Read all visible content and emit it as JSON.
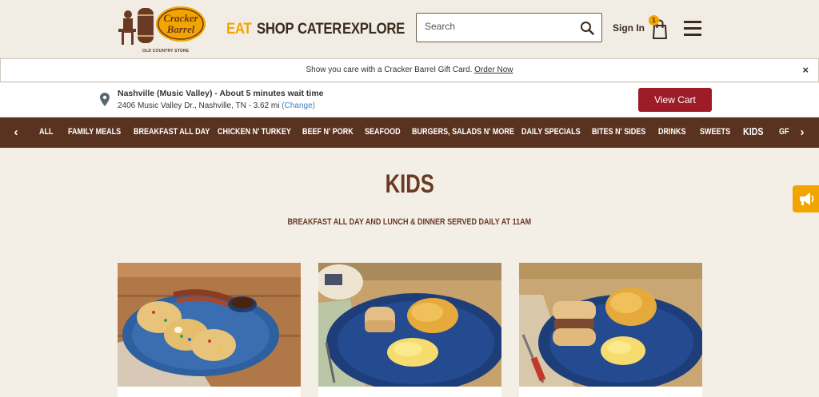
{
  "header": {
    "logo_alt": "Cracker Barrel",
    "logo_subtitle": "OLD COUNTRY STORE",
    "nav": [
      {
        "label": "EAT",
        "active": true
      },
      {
        "label": "SHOP",
        "active": false
      },
      {
        "label": "CATER",
        "active": false
      },
      {
        "label": "EXPLORE",
        "active": false
      }
    ],
    "search_placeholder": "Search",
    "signin_label": "Sign In",
    "cart_count": "1"
  },
  "banner": {
    "text": "Show you care with a Cracker Barrel Gift Card.",
    "link": "Order Now",
    "close": "×"
  },
  "location": {
    "name": "Nashville (Music Valley) - About 5 minutes wait time",
    "address": "2406 Music Valley Dr., Nashville, TN - 3.62 mi",
    "change_link": "(Change)",
    "view_cart_label": "View Cart"
  },
  "categories": {
    "prev": "‹",
    "next": "›",
    "items": [
      {
        "label": "ALL"
      },
      {
        "label": "FAMILY MEALS"
      },
      {
        "label": "BREAKFAST ALL DAY"
      },
      {
        "label": "CHICKEN N' TURKEY"
      },
      {
        "label": "BEEF N' PORK"
      },
      {
        "label": "SEAFOOD"
      },
      {
        "label": "BURGERS, SALADS N' MORE"
      },
      {
        "label": "DAILY SPECIALS"
      },
      {
        "label": "BITES N' SIDES"
      },
      {
        "label": "DRINKS"
      },
      {
        "label": "SWEETS"
      },
      {
        "label": "KIDS",
        "active": true
      },
      {
        "label": "GF"
      }
    ]
  },
  "page": {
    "title": "KIDS",
    "subtitle": "BREAKFAST ALL DAY AND LUNCH & DINNER SERVED DAILY AT 11AM"
  },
  "colors": {
    "accent": "#f2a400",
    "brown_bar": "#5a3320",
    "view_cart": "#9e1b28",
    "title": "#6b3a24"
  },
  "icons": [
    "search-icon",
    "cart-icon",
    "menu-icon",
    "pin-icon",
    "close-icon",
    "megaphone-icon"
  ]
}
